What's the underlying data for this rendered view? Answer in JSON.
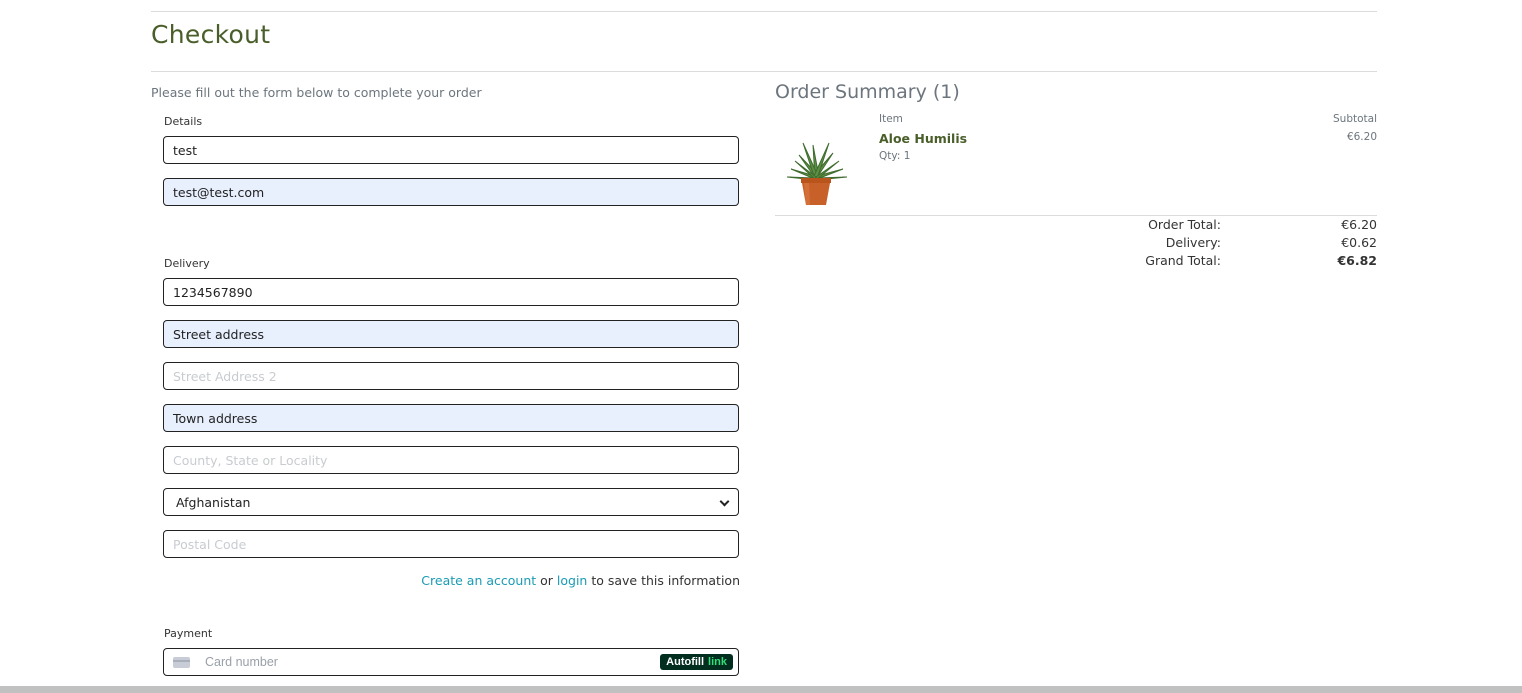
{
  "page": {
    "title": "Checkout",
    "subtitle": "Please fill out the form below to complete your order"
  },
  "details": {
    "label": "Details",
    "full_name": {
      "value": "test"
    },
    "email": {
      "value": "test@test.com"
    }
  },
  "delivery": {
    "label": "Delivery",
    "phone": {
      "value": "1234567890"
    },
    "street1": {
      "value": "Street address"
    },
    "street2": {
      "placeholder": "Street Address 2"
    },
    "town": {
      "value": "Town address"
    },
    "county": {
      "placeholder": "County, State or Locality"
    },
    "country": {
      "selected": "Afghanistan"
    },
    "postcode": {
      "placeholder": "Postal Code"
    },
    "save": {
      "create_link": "Create an account",
      "or": " or ",
      "login_link": "login",
      "suffix": " to save this information"
    }
  },
  "payment": {
    "label": "Payment",
    "card_placeholder": "Card number",
    "autofill": {
      "word": "Autofill",
      "link": "link"
    }
  },
  "summary": {
    "title": "Order Summary (1)",
    "col_item": "Item",
    "col_subtotal": "Subtotal",
    "items": [
      {
        "name": "Aloe Humilis",
        "qty": "Qty: 1",
        "subtotal": "€6.20",
        "image_icon": "potted-aloe-plant"
      }
    ],
    "order_total_label": "Order Total:",
    "order_total": "€6.20",
    "delivery_label": "Delivery:",
    "delivery": "€0.62",
    "grand_total_label": "Grand Total:",
    "grand_total": "€6.82"
  },
  "colors": {
    "accent_green": "#4a5e2a",
    "link": "#1a9bb5",
    "autofill_bg": "#e8f0fe"
  }
}
